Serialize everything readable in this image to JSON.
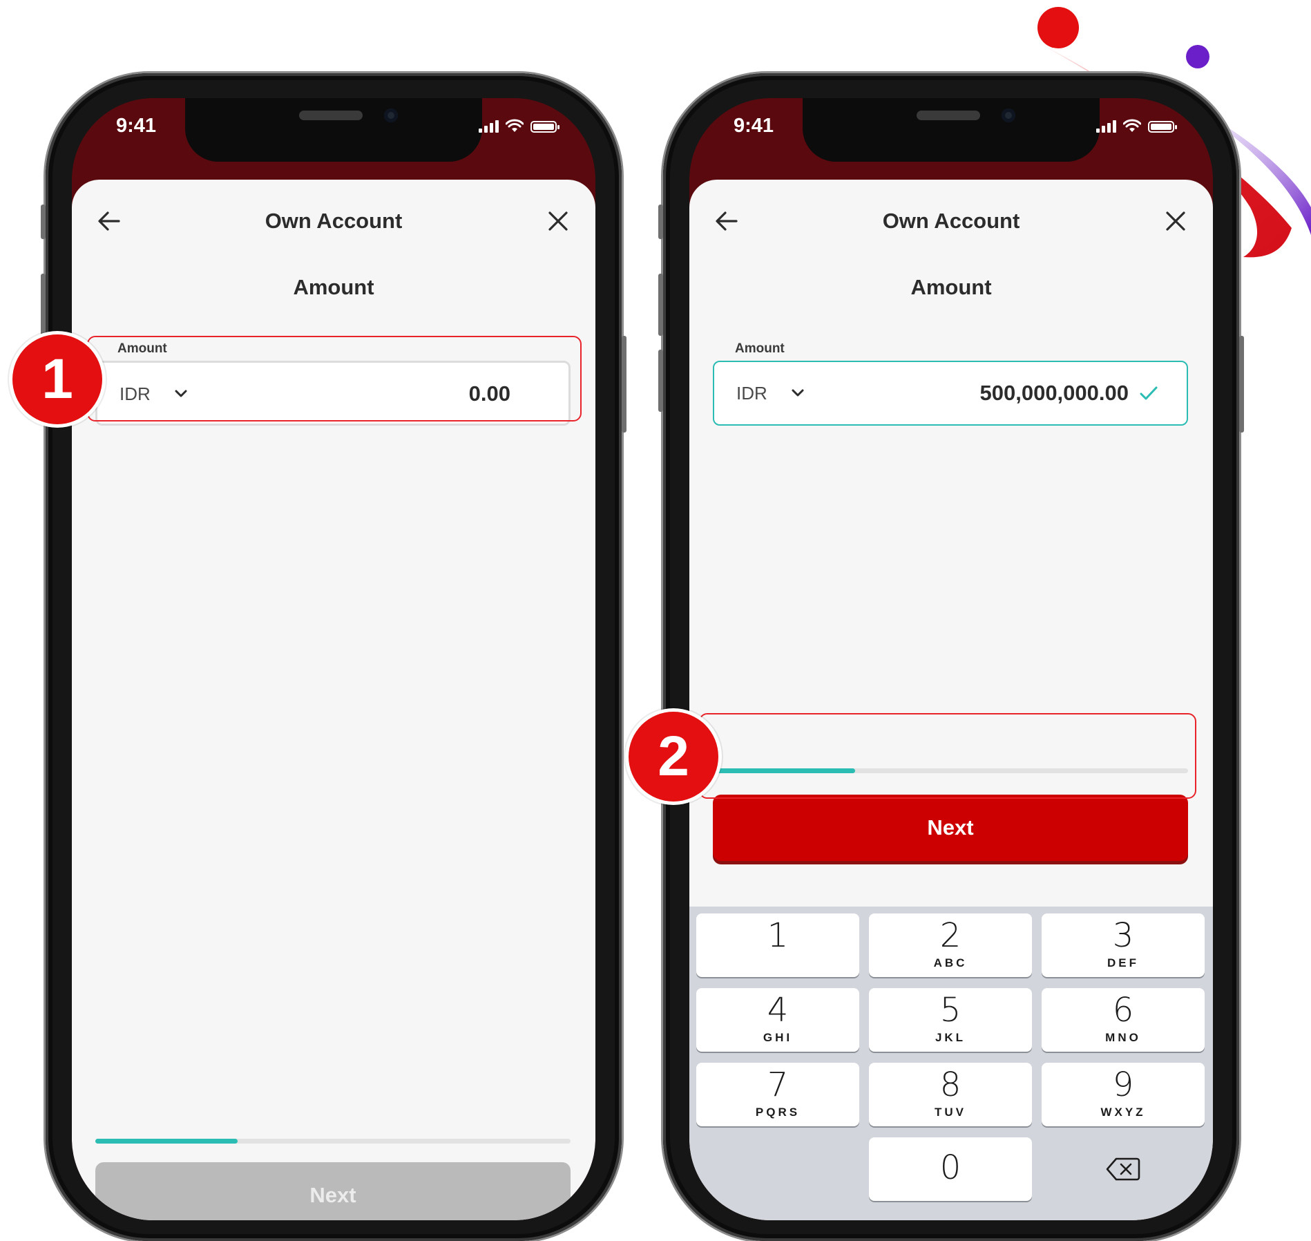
{
  "left_phone": {
    "status": {
      "time": "9:41"
    },
    "header": {
      "title": "Own Account"
    },
    "section_title": "Amount",
    "amount_field": {
      "label": "Amount",
      "currency": "IDR",
      "value": "0.00"
    },
    "progress": {
      "fraction": 0.3
    },
    "next_button": {
      "label": "Next",
      "state": "disabled"
    },
    "step_badge": "1"
  },
  "right_phone": {
    "status": {
      "time": "9:41"
    },
    "header": {
      "title": "Own Account"
    },
    "section_title": "Amount",
    "amount_field": {
      "label": "Amount",
      "currency": "IDR",
      "value": "500,000,000.00",
      "valid": true
    },
    "progress": {
      "fraction": 0.3
    },
    "next_button": {
      "label": "Next",
      "state": "enabled"
    },
    "step_badge": "2",
    "keypad": {
      "keys": [
        {
          "num": "1",
          "letters": ""
        },
        {
          "num": "2",
          "letters": "ABC"
        },
        {
          "num": "3",
          "letters": "DEF"
        },
        {
          "num": "4",
          "letters": "GHI"
        },
        {
          "num": "5",
          "letters": "JKL"
        },
        {
          "num": "6",
          "letters": "MNO"
        },
        {
          "num": "7",
          "letters": "PQRS"
        },
        {
          "num": "8",
          "letters": "TUV"
        },
        {
          "num": "9",
          "letters": "WXYZ"
        },
        {
          "num": "0",
          "letters": ""
        }
      ],
      "delete_icon": "backspace-icon"
    }
  },
  "colors": {
    "brand_red": "#cc0000",
    "header_dark_red": "#5a0a0e",
    "teal_accent": "#2bbcb4",
    "highlight_red": "#e8232a",
    "disabled_gray": "#bababa"
  },
  "icons": [
    "back-arrow-icon",
    "close-icon",
    "chevron-down-icon",
    "check-icon",
    "signal-icon",
    "wifi-icon",
    "battery-icon",
    "backspace-icon",
    "brand-swoosh-logo"
  ]
}
